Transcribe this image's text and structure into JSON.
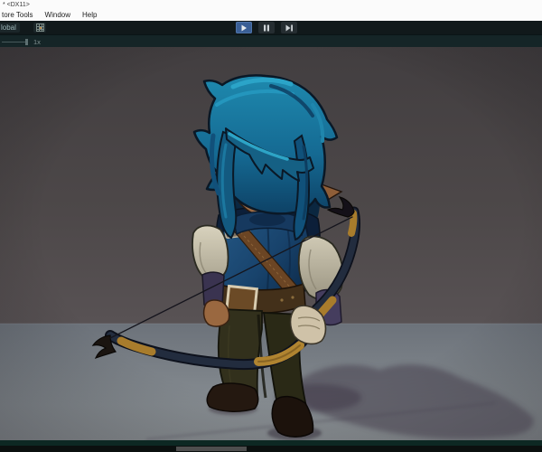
{
  "window": {
    "title": "* <DX11>"
  },
  "menu": {
    "items": [
      "tore Tools",
      "Window",
      "Help"
    ]
  },
  "toolbar": {
    "pivot_label": "lobal",
    "grid_icon": "grid-snap-icon",
    "playback": {
      "play_icon": "play-icon",
      "pause_icon": "pause-icon",
      "step_icon": "step-forward-icon",
      "play_active": true,
      "play_active_color": "#3a5f96"
    }
  },
  "preview": {
    "speed_label": "1x"
  },
  "viewport": {
    "subject": "stylized child archer with blue hair holding a recurve bow, standing on gray floor with cast shadow",
    "colors": {
      "background_top": "#444042",
      "background_bottom": "#575153",
      "floor_near_horizon": "#6c727a",
      "floor_bottom": "#8b9095",
      "hair": "#1c82a8",
      "hair_highlight": "#2ba4c8",
      "tunic": "#1c4a74",
      "sleeves": "#d3ccb8",
      "pants": "#302e1b",
      "bow_gold": "#a87c2c",
      "shadow": "#423a4a"
    }
  },
  "bottom": {
    "scrollbar": "horizontal-scrollbar-thumb"
  }
}
